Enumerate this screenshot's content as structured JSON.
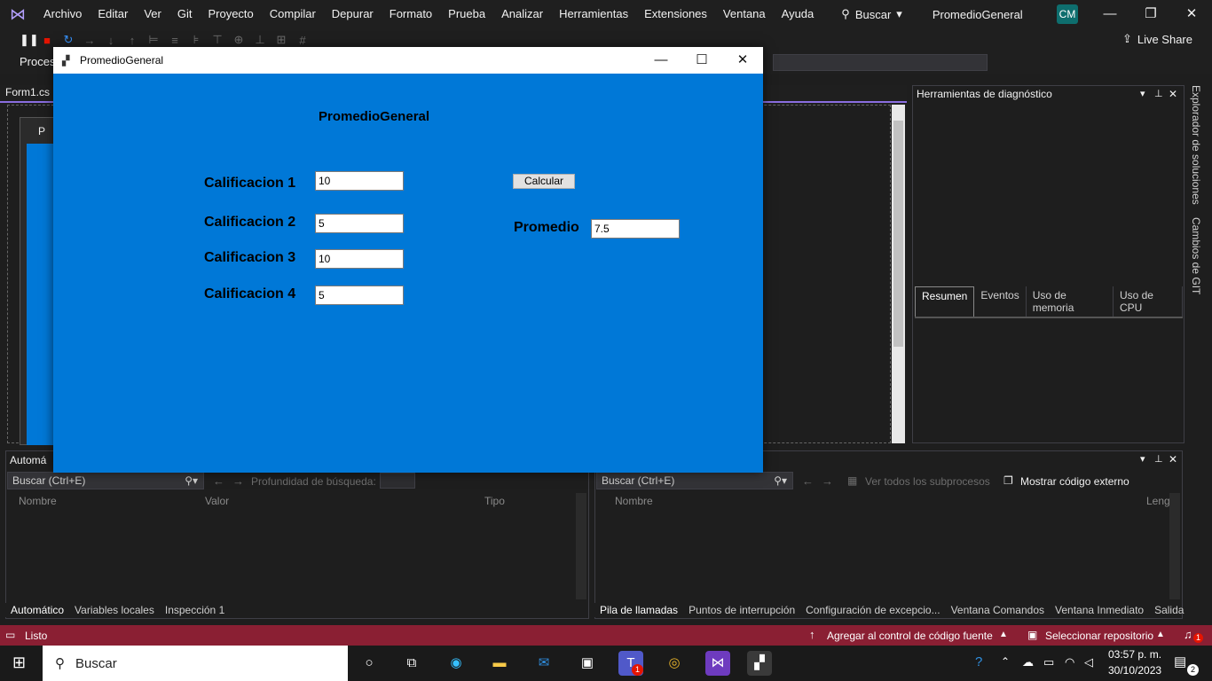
{
  "ide": {
    "menu": [
      "Archivo",
      "Editar",
      "Ver",
      "Git",
      "Proyecto",
      "Compilar",
      "Depurar",
      "Formato",
      "Prueba",
      "Analizar",
      "Herramientas",
      "Extensiones",
      "Ventana",
      "Ayuda"
    ],
    "search_label": "Buscar",
    "solution_name": "PromedioGeneral",
    "avatar_initials": "CM",
    "live_share": "Live Share",
    "process_label": "Proces",
    "doc_tab": "Form1.cs",
    "designer_form_caption": "P"
  },
  "diagnostics": {
    "title": "Herramientas de diagnóstico",
    "tabs": [
      "Resumen",
      "Eventos",
      "Uso de memoria",
      "Uso de CPU"
    ],
    "side_tabs": [
      "Explorador de soluciones",
      "Cambios de GIT"
    ]
  },
  "autos_panel": {
    "title": "Automá",
    "search_placeholder": "Buscar (Ctrl+E)",
    "depth_label": "Profundidad de búsqueda:",
    "columns": [
      "Nombre",
      "Valor",
      "Tipo"
    ],
    "tabs": [
      "Automático",
      "Variables locales",
      "Inspección 1"
    ]
  },
  "callstack_panel": {
    "search_placeholder": "Buscar (Ctrl+E)",
    "threads_label": "Ver todos los subprocesos",
    "external_code_label": "Mostrar código externo",
    "columns": [
      "Nombre",
      "Leng"
    ],
    "tabs": [
      "Pila de llamadas",
      "Puntos de interrupción",
      "Configuración de excepcio...",
      "Ventana Comandos",
      "Ventana Inmediato",
      "Salida"
    ]
  },
  "status": {
    "ready": "Listo",
    "add_source_control": "Agregar al control de código fuente",
    "select_repo": "Seleccionar repositorio",
    "notifications": "1"
  },
  "taskbar": {
    "search_label": "Buscar",
    "time": "03:57 p. m.",
    "date": "30/10/2023",
    "notification_count": "2",
    "teams_badge": "1"
  },
  "app": {
    "window_title": "PromedioGeneral",
    "header": "PromedioGeneral",
    "grades": [
      {
        "label": "Calificacion 1",
        "value": "10"
      },
      {
        "label": "Calificacion 2",
        "value": "5"
      },
      {
        "label": "Calificacion 3",
        "value": "10"
      },
      {
        "label": "Calificacion 4",
        "value": "5"
      }
    ],
    "calc_button": "Calcular",
    "avg_label": "Promedio",
    "avg_value": "7.5"
  },
  "colors": {
    "form_background": "#0078d7",
    "statusbar": "#8a1f33",
    "accent": "#8a6ee0"
  }
}
